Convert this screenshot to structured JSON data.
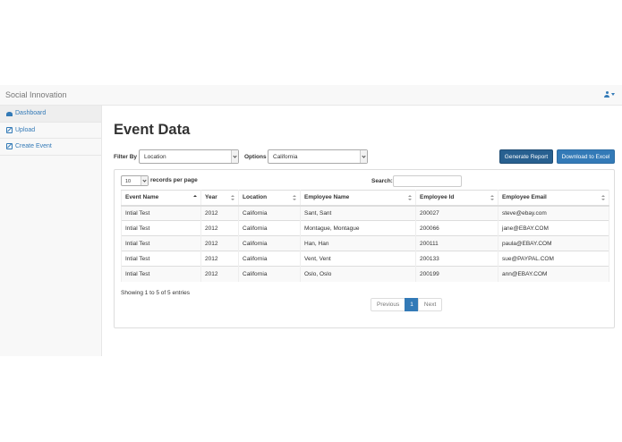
{
  "navbar": {
    "brand": "Social Innovation"
  },
  "sidebar": {
    "items": [
      {
        "label": "Dashboard",
        "icon": "dashboard-icon"
      },
      {
        "label": "Upload",
        "icon": "edit-icon"
      },
      {
        "label": "Create Event",
        "icon": "edit-icon"
      }
    ]
  },
  "page": {
    "title": "Event Data"
  },
  "filters": {
    "filter_by_label": "Filter By",
    "filter_by_value": "Location",
    "options_label": "Options",
    "options_value": "California",
    "generate_report": "Generate Report",
    "download_excel": "Download to Excel"
  },
  "table_controls": {
    "page_length": "10",
    "page_length_label": "records per page",
    "search_label": "Search:"
  },
  "table": {
    "headers": [
      "Event Name",
      "Year",
      "Location",
      "Employee Name",
      "Employee Id",
      "Employee Email"
    ],
    "rows": [
      [
        "Intial Test",
        "2012",
        "California",
        "Sant, Sant",
        "200027",
        "steve@ebay.com"
      ],
      [
        "Intial Test",
        "2012",
        "California",
        "Montague, Montague",
        "200066",
        "jane@EBAY.COM"
      ],
      [
        "Intial Test",
        "2012",
        "California",
        "Han, Han",
        "200111",
        "paula@EBAY.COM"
      ],
      [
        "Intial Test",
        "2012",
        "California",
        "Vent, Vent",
        "200133",
        "sue@PAYPAL.COM"
      ],
      [
        "Intial Test",
        "2012",
        "California",
        "Oslo, Oslo",
        "200199",
        "ann@EBAY.COM"
      ]
    ]
  },
  "footer": {
    "info": "Showing 1 to 5 of 5 entries",
    "previous": "Previous",
    "page": "1",
    "next": "Next"
  },
  "colors": {
    "accent": "#337ab7",
    "nav_bg": "#f8f8f8"
  }
}
